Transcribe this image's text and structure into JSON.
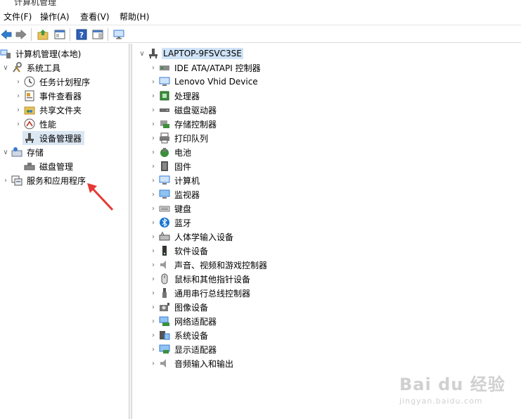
{
  "window": {
    "title": "计算机管理"
  },
  "menu": [
    "文件(F)",
    "操作(A)",
    "查看(V)",
    "帮助(H)"
  ],
  "toolbar": [
    "back-icon",
    "forward-icon",
    "up-folder-icon",
    "properties-icon",
    "help-icon",
    "view-icon",
    "monitor-icon"
  ],
  "left_tree": {
    "root": "计算机管理(本地)",
    "system_tools": "系统工具",
    "task_scheduler": "任务计划程序",
    "event_viewer": "事件查看器",
    "shared_folders": "共享文件夹",
    "performance": "性能",
    "device_manager": "设备管理器",
    "storage": "存储",
    "disk_management": "磁盘管理",
    "services_apps": "服务和应用程序"
  },
  "device_tree": {
    "host": "LAPTOP-9FSVC3SE",
    "categories": [
      "IDE ATA/ATAPI 控制器",
      "Lenovo Vhid Device",
      "处理器",
      "磁盘驱动器",
      "存储控制器",
      "打印队列",
      "电池",
      "固件",
      "计算机",
      "监视器",
      "键盘",
      "蓝牙",
      "人体学输入设备",
      "软件设备",
      "声音、视频和游戏控制器",
      "鼠标和其他指针设备",
      "通用串行总线控制器",
      "图像设备",
      "网络适配器",
      "系统设备",
      "显示适配器",
      "音频输入和输出"
    ]
  },
  "watermark": {
    "main": "Bai du 经验",
    "sub": "jingyan.baidu.com"
  }
}
